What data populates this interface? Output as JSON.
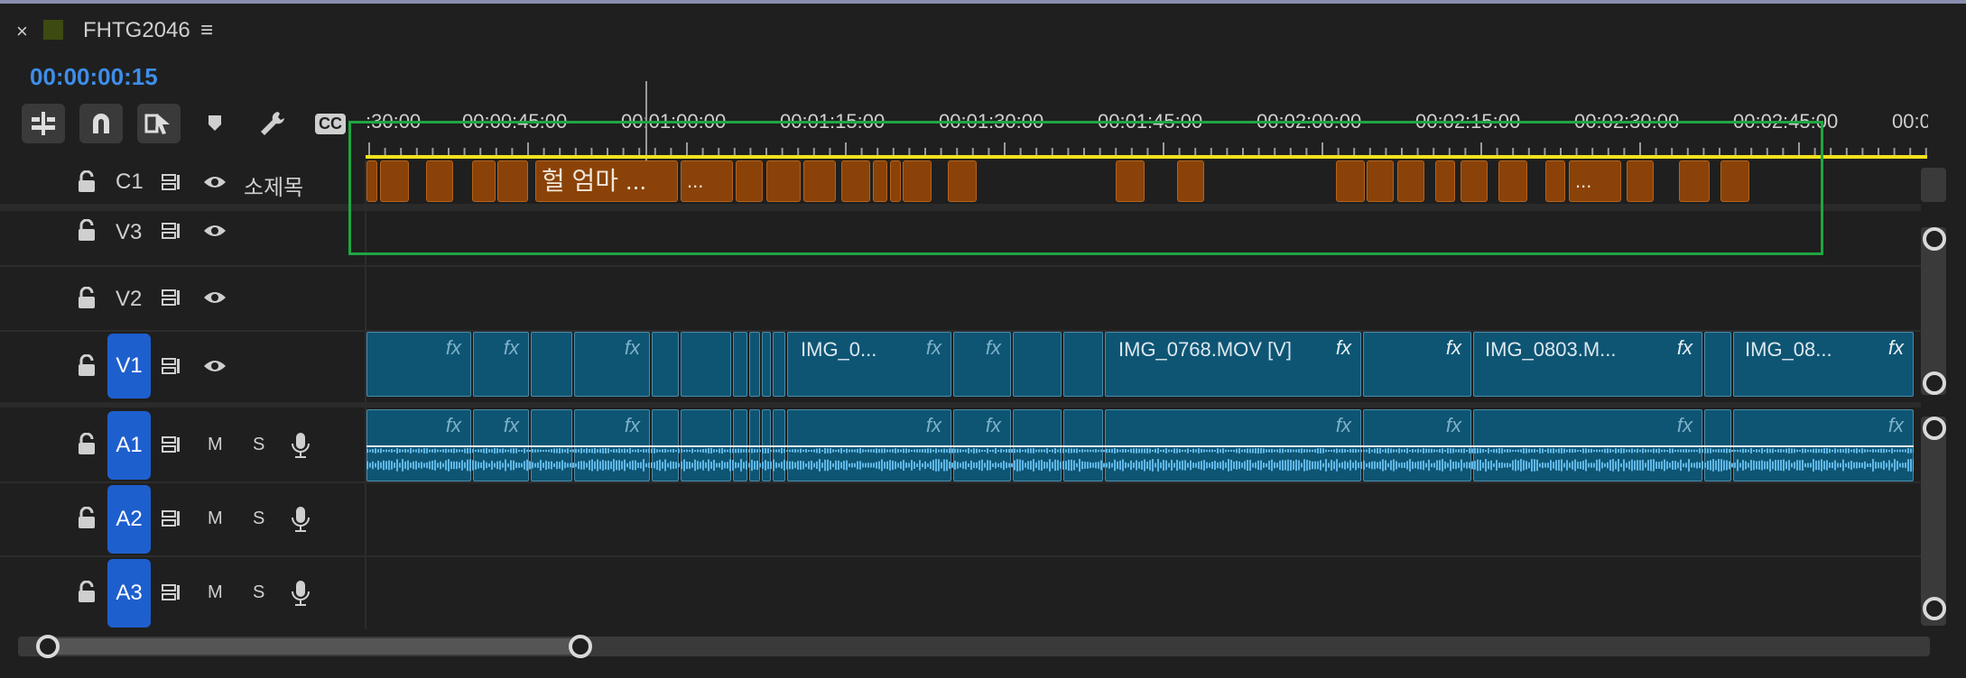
{
  "sequence": {
    "close_glyph": "×",
    "name": "FHTG2046",
    "menu_glyph": "≡",
    "label_color": "#3d4a12",
    "timecode": "00:00:00:15"
  },
  "toolbar": {
    "tools": [
      "insert-overwrite-icon",
      "snap-magnet-icon",
      "linked-selection-icon",
      "add-marker-icon",
      "wrench-settings-icon",
      "captions-cc-icon"
    ],
    "cc_label": "CC"
  },
  "ruler": {
    "labels": [
      ":30:00",
      "00:00:45:00",
      "00:01:00:00",
      "00:01:15:00",
      "00:01:30:00",
      "00:01:45:00",
      "00:02:00:00",
      "00:02:15:00",
      "00:02:30:00",
      "00:02:45:00",
      "00:0"
    ]
  },
  "tracks": {
    "c1": {
      "name": "C1",
      "title": "소제목"
    },
    "v3": {
      "name": "V3"
    },
    "v2": {
      "name": "V2"
    },
    "v1": {
      "name": "V1"
    },
    "a1": {
      "name": "A1",
      "m": "M",
      "s": "S"
    },
    "a2": {
      "name": "A2",
      "m": "M",
      "s": "S"
    },
    "a3": {
      "name": "A3",
      "m": "M",
      "s": "S"
    }
  },
  "captions": {
    "c1_text": "헐 엄마 ...",
    "c2_text": "...",
    "c3_text": "..."
  },
  "video_clips": {
    "clip_a": "IMG_0...",
    "clip_b": "IMG_0768.MOV [V]",
    "clip_c": "IMG_0803.M...",
    "clip_d": "IMG_08...",
    "fx_label": "fx"
  },
  "colors": {
    "timecode": "#3d8eea",
    "track_badge": "#1e5fce",
    "caption_clip": "#8a4208",
    "video_clip": "#0e5574",
    "waveform": "#5fb6e6",
    "highlight_box": "#1fa642",
    "work_area": "#f2e21d"
  }
}
